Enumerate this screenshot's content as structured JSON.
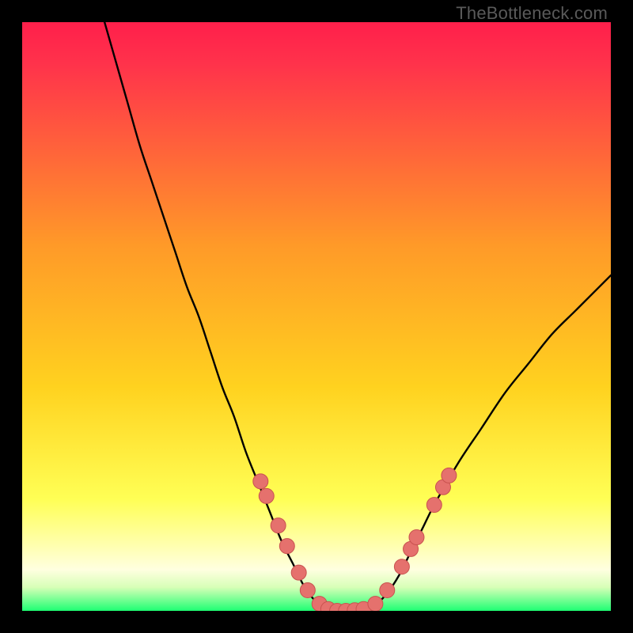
{
  "watermark": "TheBottleneck.com",
  "colors": {
    "gradient_top": "#ff1f4b",
    "gradient_mid1": "#ff7a2a",
    "gradient_mid2": "#ffd21f",
    "gradient_light": "#ffff9a",
    "gradient_pale": "#ffffd7",
    "gradient_bottom": "#1eff73",
    "curve": "#000000",
    "marker_fill": "#e5716d",
    "marker_stroke": "#c9524f"
  },
  "chart_data": {
    "type": "line",
    "title": "",
    "xlabel": "",
    "ylabel": "",
    "xlim": [
      0,
      100
    ],
    "ylim": [
      0,
      100
    ],
    "series": [
      {
        "name": "bottleneck-curve",
        "x": [
          14,
          16,
          18,
          20,
          22,
          24,
          26,
          28,
          30,
          32,
          34,
          36,
          38,
          40,
          42,
          44,
          46,
          48,
          50,
          52,
          54,
          56,
          58,
          60,
          62,
          64,
          66,
          68,
          70,
          74,
          78,
          82,
          86,
          90,
          94,
          98,
          100
        ],
        "y": [
          100,
          93,
          86,
          79,
          73,
          67,
          61,
          55,
          50,
          44,
          38,
          33,
          27,
          22,
          17,
          12,
          8,
          4,
          1.5,
          0.3,
          0,
          0,
          0.2,
          1,
          3,
          6,
          10,
          14,
          18,
          25,
          31,
          37,
          42,
          47,
          51,
          55,
          57
        ]
      }
    ],
    "markers": {
      "name": "highlighted-points",
      "points": [
        {
          "x": 40.5,
          "y": 22
        },
        {
          "x": 41.5,
          "y": 19.5
        },
        {
          "x": 43.5,
          "y": 14.5
        },
        {
          "x": 45,
          "y": 11
        },
        {
          "x": 47,
          "y": 6.5
        },
        {
          "x": 48.5,
          "y": 3.5
        },
        {
          "x": 50.5,
          "y": 1.2
        },
        {
          "x": 52,
          "y": 0.3
        },
        {
          "x": 53.5,
          "y": 0
        },
        {
          "x": 55,
          "y": 0
        },
        {
          "x": 56.5,
          "y": 0.1
        },
        {
          "x": 58,
          "y": 0.3
        },
        {
          "x": 60,
          "y": 1.2
        },
        {
          "x": 62,
          "y": 3.5
        },
        {
          "x": 64.5,
          "y": 7.5
        },
        {
          "x": 66,
          "y": 10.5
        },
        {
          "x": 67,
          "y": 12.5
        },
        {
          "x": 70,
          "y": 18
        },
        {
          "x": 71.5,
          "y": 21
        },
        {
          "x": 72.5,
          "y": 23
        }
      ]
    }
  }
}
